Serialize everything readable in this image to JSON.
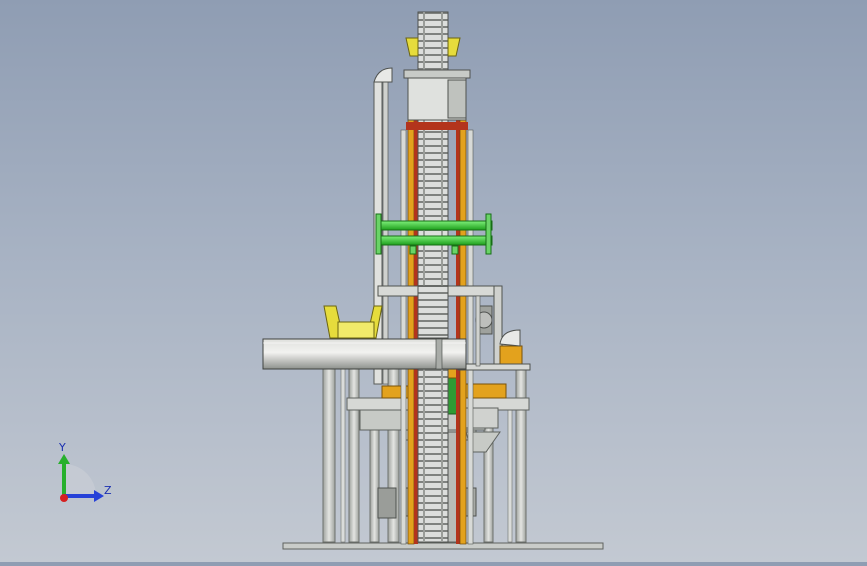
{
  "viewport": {
    "background_top": "#8f9db3",
    "background_bottom": "#c3c9d2"
  },
  "colors": {
    "frame": "#c9ccc9",
    "frame_dark": "#6f7470",
    "conveyor": "#d8dad8",
    "conveyor_link": "#7a7d7a",
    "yellow": "#e6dc3c",
    "green": "#35d431",
    "red": "#b3341c",
    "orange": "#e3a21d",
    "disc": "#b4b6b2"
  },
  "triad": {
    "y_label": "Y",
    "z_label": "Z",
    "x_color": "#d52020",
    "y_color": "#27b02c",
    "z_color": "#2641d8"
  }
}
